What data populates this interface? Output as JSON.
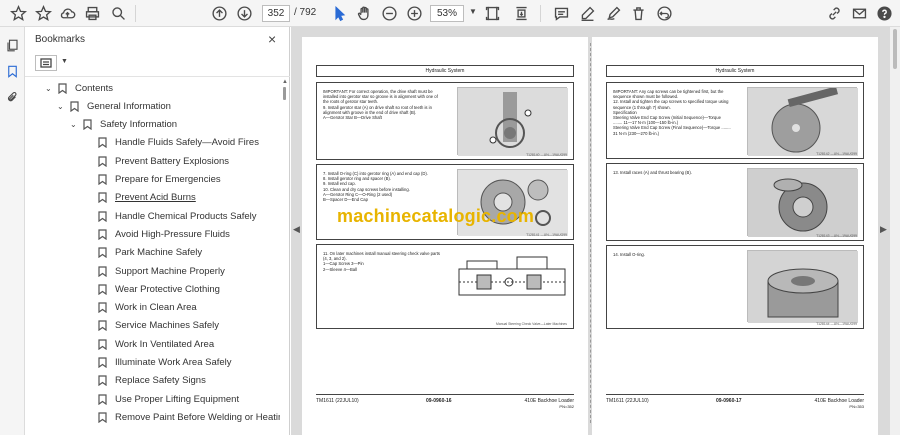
{
  "toolbar": {
    "page_current": "352",
    "page_total": "/ 792",
    "zoom": "53%"
  },
  "bookmarks": {
    "title": "Bookmarks",
    "close_label": "×",
    "items": [
      {
        "label": "Contents",
        "level": 0,
        "caret": "⌄",
        "flag": true
      },
      {
        "label": "General Information",
        "level": 1,
        "caret": "⌄",
        "flag": true
      },
      {
        "label": "Safety Information",
        "level": 2,
        "caret": "⌄",
        "flag": true
      },
      {
        "label": "Handle Fluids Safely—Avoid Fires",
        "level": 3,
        "caret": "",
        "flag": true
      },
      {
        "label": "Prevent Battery Explosions",
        "level": 3,
        "caret": "",
        "flag": true
      },
      {
        "label": "Prepare for Emergencies",
        "level": 3,
        "caret": "",
        "flag": true
      },
      {
        "label": "Prevent Acid Burns",
        "level": 3,
        "caret": "",
        "flag": true,
        "highlight": true
      },
      {
        "label": "Handle Chemical Products Safely",
        "level": 3,
        "caret": "",
        "flag": true
      },
      {
        "label": "Avoid High-Pressure Fluids",
        "level": 3,
        "caret": "",
        "flag": true
      },
      {
        "label": "Park Machine Safely",
        "level": 3,
        "caret": "",
        "flag": true
      },
      {
        "label": "Support Machine Properly",
        "level": 3,
        "caret": "",
        "flag": true
      },
      {
        "label": "Wear Protective Clothing",
        "level": 3,
        "caret": "",
        "flag": true
      },
      {
        "label": "Work in Clean Area",
        "level": 3,
        "caret": "",
        "flag": true
      },
      {
        "label": "Service Machines Safely",
        "level": 3,
        "caret": "",
        "flag": true
      },
      {
        "label": "Work In Ventilated Area",
        "level": 3,
        "caret": "",
        "flag": true
      },
      {
        "label": "Illuminate Work Area Safely",
        "level": 3,
        "caret": "",
        "flag": true
      },
      {
        "label": "Replace Safety Signs",
        "level": 3,
        "caret": "",
        "flag": true
      },
      {
        "label": "Use Proper Lifting Equipment",
        "level": 3,
        "caret": "",
        "flag": true
      },
      {
        "label": "Remove Paint Before Welding or Heating",
        "level": 3,
        "caret": "",
        "flag": true
      }
    ]
  },
  "document": {
    "watermark": "machinecatalogic.com",
    "page_left": {
      "header": "Hydraulic System",
      "sections": [
        {
          "text": "IMPORTANT: For correct operation, the drive shaft must be installed into gerotor star so groove is in alignment with one of the roots of gerotor star teeth.\n9. Install gerotor star (A) on drive shaft so root of teeth is in alignment with groove in the end of drive shaft (B).\nA—Gerotor Star    B—Drive Shaft",
          "caption": "T128140 —UN—19AUG99"
        },
        {
          "text": "7. Install O-ring (C) into gerotor ring (A) and end cap (D).\n8. Install gerotor ring and spacer (B).\n9. Install end cap.\n10. Clean and dry cap screws before installing.\nA—Gerotor Ring    C—O-Ring (2 used)\nB—Spacer    D—End Cap",
          "caption": "T128141 —UN—19AUG99"
        },
        {
          "text": "11. On later machines install manual steering check valve parts (4, 3, and 2).\n1—Cap Screw    3—Pin\n2—Sleeve    4—Ball",
          "caption": "Manual Steering Check Valve—Later Machines"
        }
      ],
      "footer": {
        "left": "TM1611 (22JUL10)",
        "center": "09-0960-16",
        "right": "410E Backhoe Loader",
        "pagenum": "PN=352"
      }
    },
    "page_right": {
      "header": "Hydraulic System",
      "sections": [
        {
          "text": "IMPORTANT: Any cap screws can be tightened first, but the sequence shown must be followed.\n12. Install and tighten the cap screws to specified torque using sequence (1 through 7) shown.\nSpecification\nSteering Valve End Cap Screw (Initial Sequence)—Torque ........ 11—17 N·m (100—150 lb-in.)\nSteering Valve End Cap Screw (Final Sequence)—Torque ........ 31 N·m (230—270 lb-in.)",
          "caption": "T128142 —UN—19AUG99"
        },
        {
          "text": "13. Install races (A) and thrust bearing (B).",
          "caption": "T128143 —UN—19AUG99"
        },
        {
          "text": "14. Install O-ring.",
          "caption": "T128144 —UN—19AUG99"
        }
      ],
      "footer": {
        "left": "TM1611 (22JUL10)",
        "center": "09-0960-17",
        "right": "410E Backhoe Loader",
        "pagenum": "PN=353"
      }
    }
  }
}
